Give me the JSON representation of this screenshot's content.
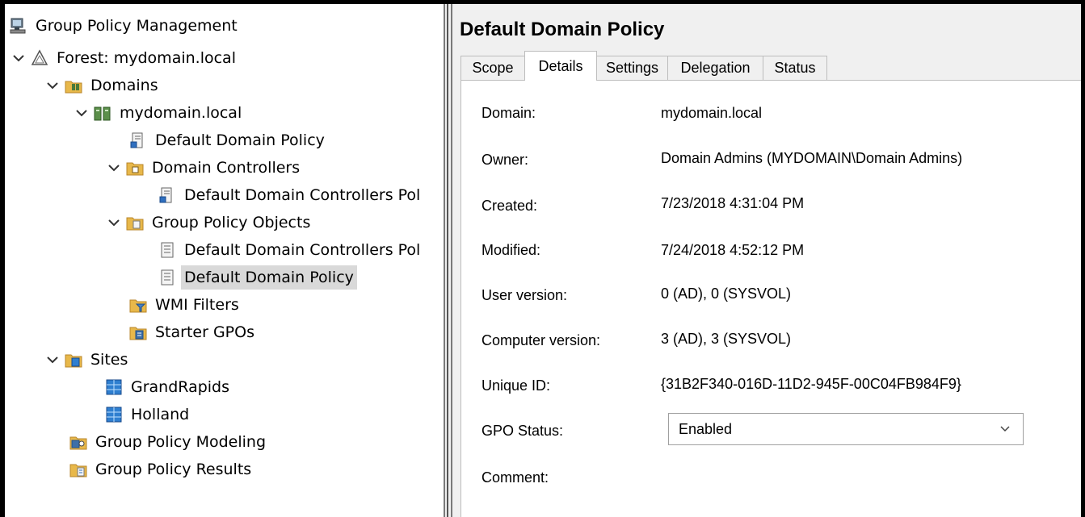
{
  "tree": {
    "root": "Group Policy Management",
    "forest": "Forest: mydomain.local",
    "domains": "Domains",
    "domain": "mydomain.local",
    "default_domain_policy_link": "Default Domain Policy",
    "domain_controllers": "Domain Controllers",
    "ddc_policy_link": "Default Domain Controllers Pol",
    "gpo_container": "Group Policy Objects",
    "gpo_ddc_policy": "Default Domain Controllers Pol",
    "gpo_default_domain_policy": "Default Domain Policy",
    "wmi_filters": "WMI Filters",
    "starter_gpos": "Starter GPOs",
    "sites": "Sites",
    "site_grandrapids": "GrandRapids",
    "site_holland": "Holland",
    "modeling": "Group Policy Modeling",
    "results": "Group Policy Results"
  },
  "details": {
    "title": "Default Domain Policy",
    "tabs": [
      "Scope",
      "Details",
      "Settings",
      "Delegation",
      "Status"
    ],
    "active_tab": "Details",
    "fields": {
      "domain_label": "Domain:",
      "domain_value": "mydomain.local",
      "owner_label": "Owner:",
      "owner_value": "Domain Admins (MYDOMAIN\\Domain Admins)",
      "created_label": "Created:",
      "created_value": "7/23/2018 4:31:04 PM",
      "modified_label": "Modified:",
      "modified_value": "7/24/2018 4:52:12 PM",
      "user_version_label": "User version:",
      "user_version_value": "0 (AD), 0 (SYSVOL)",
      "computer_version_label": "Computer version:",
      "computer_version_value": "3 (AD), 3 (SYSVOL)",
      "unique_id_label": "Unique ID:",
      "unique_id_value": "{31B2F340-016D-11D2-945F-00C04FB984F9}",
      "gpo_status_label": "GPO Status:",
      "gpo_status_value": "Enabled",
      "comment_label": "Comment:"
    }
  },
  "colors": {
    "selection": "#d9d9d9",
    "panel_bg": "#f0f0f0",
    "folder": "#e8b84a",
    "site_blue": "#2f7fd0"
  }
}
